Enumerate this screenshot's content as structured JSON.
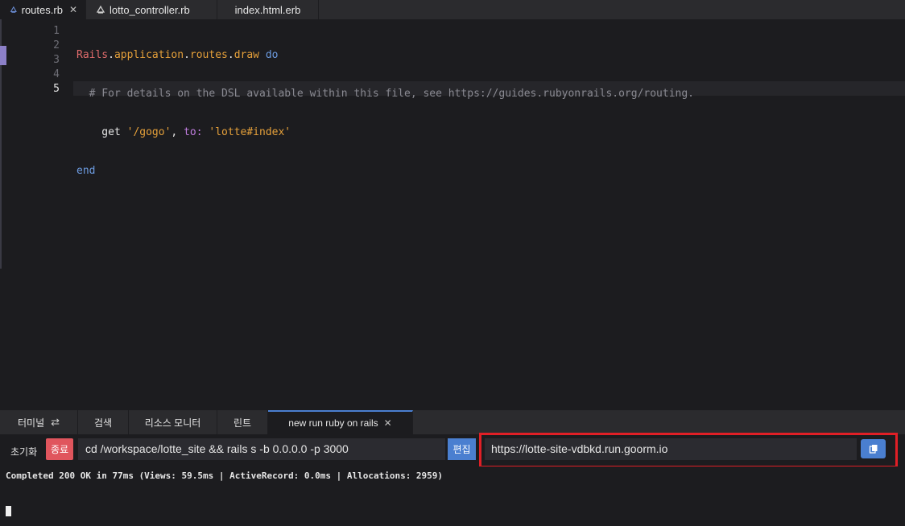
{
  "editor_tabs": [
    {
      "label": "routes.rb",
      "active": true,
      "closable": true,
      "icon": "ruby-file-icon"
    },
    {
      "label": "lotto_controller.rb",
      "active": false,
      "closable": false,
      "icon": "ruby-file-icon"
    },
    {
      "label": "index.html.erb",
      "active": false,
      "closable": false,
      "icon": ""
    }
  ],
  "editor": {
    "line_numbers": [
      "1",
      "2",
      "3",
      "4",
      "5"
    ],
    "current_line": "5",
    "lines": [
      [
        "Rails",
        ".",
        "application",
        ".",
        "routes",
        ".",
        "draw",
        " ",
        "do"
      ],
      [
        "  # For details on the DSL available within this file, see https://guides.rubyonrails.org/routing."
      ],
      [
        "    get ",
        "'/gogo'",
        ", ",
        "to:",
        " ",
        "'lotte#index'"
      ],
      [
        "end"
      ],
      [
        ""
      ]
    ]
  },
  "panel_tabs": [
    {
      "label": "터미널",
      "icon": "sync-icon"
    },
    {
      "label": "검색"
    },
    {
      "label": "리소스 모니터"
    },
    {
      "label": "린트"
    },
    {
      "label": "new run ruby on rails",
      "active": true,
      "closable": true
    }
  ],
  "run_toolbar": {
    "reset_label": "초기화",
    "stop_label": "종료",
    "command": "cd /workspace/lotte_site && rails s -b 0.0.0.0 -p 3000",
    "edit_label": "편집",
    "url": "https://lotte-site-vdbkd.run.goorm.io"
  },
  "terminal": {
    "output": "Completed 200 OK in 77ms (Views: 59.5ms | ActiveRecord: 0.0ms | Allocations: 2959)"
  },
  "colors": {
    "accent": "#4a7fd0",
    "stop": "#e0555d",
    "highlight_box": "#e01f26"
  }
}
